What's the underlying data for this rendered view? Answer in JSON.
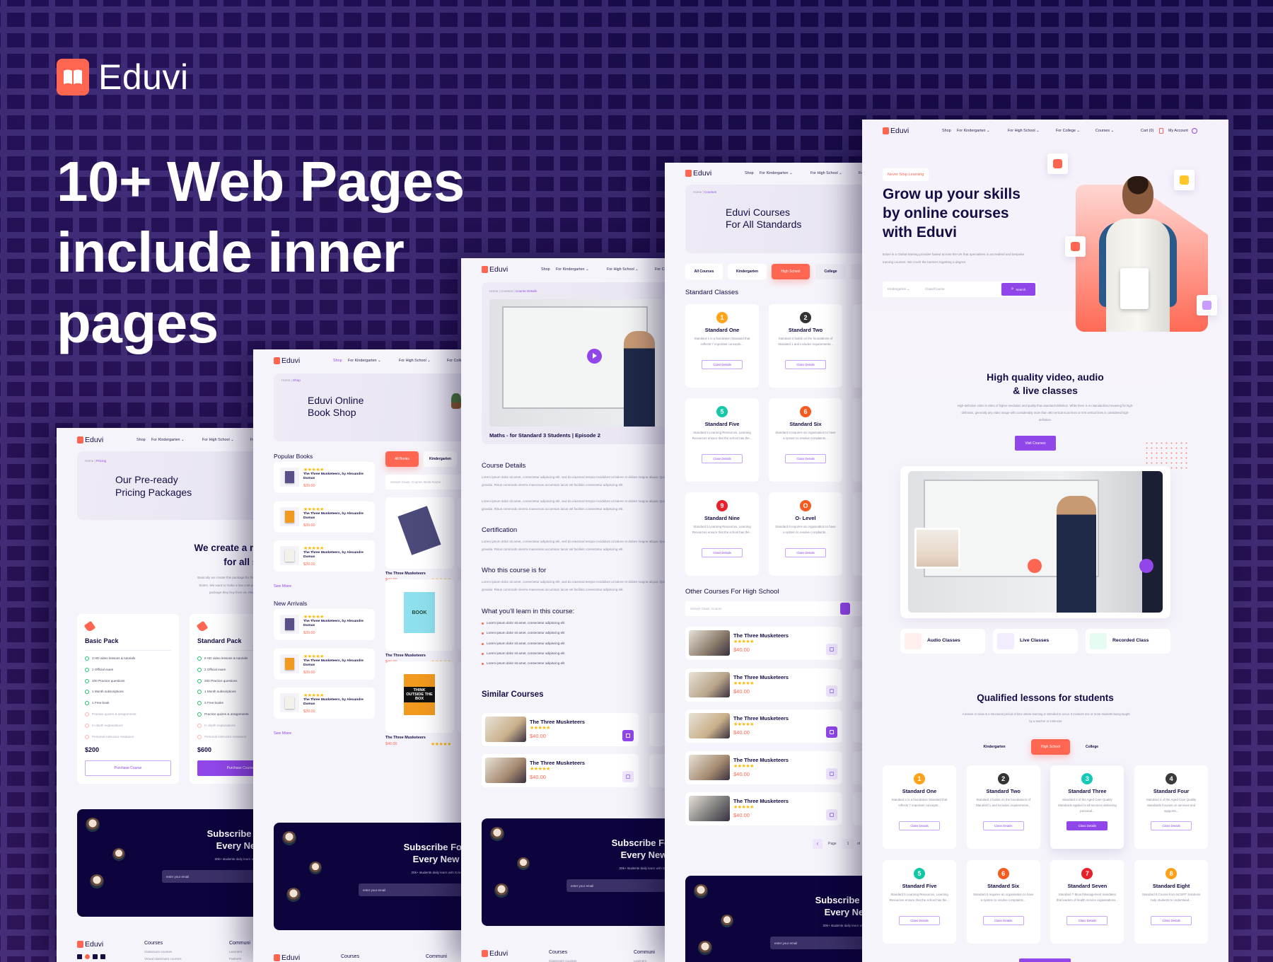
{
  "brand": {
    "name": "Eduvi"
  },
  "colors": {
    "background": "#1d0c4e",
    "accent_purple": "#9146ea",
    "accent_coral": "#ff6652",
    "navy": "#150c45",
    "panel_bg": "#f6f4fb",
    "star": "#ffb800"
  },
  "headline": [
    "10+ Web Pages",
    "include inner",
    "pages"
  ],
  "nav": {
    "items": [
      "Shop",
      "For Kindergarten",
      "For High School",
      "For College",
      "Courses"
    ],
    "cart": "Cart (0)",
    "account": "My Account"
  },
  "subscribe": {
    "title": [
      "Subscribe For Get",
      "Every New Co"
    ],
    "subtitle": "20k+ students daily learn with Eduvi. Subscri",
    "placeholder": "enter your email"
  },
  "footer": {
    "columns": [
      {
        "title": "Courses",
        "links": [
          "Classroom courses",
          "Virtual classroom courses"
        ]
      },
      {
        "title": "Communi",
        "links": [
          "Learners",
          "Partners"
        ]
      }
    ]
  },
  "pricing": {
    "breadcrumb": [
      "Home",
      "Pricing"
    ],
    "title": [
      "Our Pre-ready",
      "Pricing Packages"
    ],
    "heading": [
      "We create a monthly",
      "for all standard"
    ],
    "description": [
      "Basically we create this package for those who are really int",
      "books. We want to make a low cost package for them. So",
      "package they buy from us. Also will get free"
    ],
    "packs": [
      {
        "name": "Basic Pack",
        "price": "$200",
        "button": "Purchase Course",
        "features": [
          {
            "text": "3 HD video lessons & tutorials",
            "included": true
          },
          {
            "text": "1 Official exam",
            "included": true
          },
          {
            "text": "100 Practice questions",
            "included": true
          },
          {
            "text": "1 Month subscriptions",
            "included": true
          },
          {
            "text": "1 Free book",
            "included": true
          },
          {
            "text": "Practice quizes & assignments",
            "included": false
          },
          {
            "text": "In depth explanations",
            "included": false
          },
          {
            "text": "Personal instructor Assitance",
            "included": false
          }
        ]
      },
      {
        "name": "Standard Pack",
        "price": "$600",
        "button": "Purchase Course",
        "features": [
          {
            "text": "8 HD video lessons & tutorials",
            "included": true
          },
          {
            "text": "2 Official exam",
            "included": true
          },
          {
            "text": "200 Practice questions",
            "included": true
          },
          {
            "text": "1 Month subscriptions",
            "included": true
          },
          {
            "text": "3 Free books",
            "included": true
          },
          {
            "text": "Practice quizes & assignments",
            "included": true
          },
          {
            "text": "In depth explanations",
            "included": false
          },
          {
            "text": "Personal instructor Assitance",
            "included": false
          }
        ]
      }
    ]
  },
  "shop": {
    "breadcrumb": [
      "Home",
      "Shop"
    ],
    "title": [
      "Eduvi Online",
      "Book Shop"
    ],
    "popular_title": "Popular Books",
    "new_title": "New Arrivals",
    "see_more": "See More",
    "popular": [
      {
        "title": "The Three Musketeers, by Alexandre Dumas",
        "price": "$39.00",
        "rating": 5,
        "cover": "#5a4f86"
      },
      {
        "title": "The Three Musketeers, by Alexandre Dumas",
        "price": "$39.00",
        "rating": 5,
        "cover": "#f29a1f"
      },
      {
        "title": "The Three Musketeers, by Alexandre Dumas",
        "price": "$39.00",
        "rating": 5,
        "cover": "#f4f1ea"
      }
    ],
    "new_arrivals": [
      {
        "title": "The Three Musketeers, by Alexandre Dumas",
        "price": "$39.00",
        "rating": 5,
        "cover": "#5a4f86"
      },
      {
        "title": "The Three Musketeers, by Alexandre Dumas",
        "price": "$39.00",
        "rating": 5,
        "cover": "#f29a1f"
      },
      {
        "title": "The Three Musketeers, by Alexandre Dumas",
        "price": "$39.00",
        "rating": 5,
        "cover": "#f4f1ea"
      }
    ],
    "tabs": [
      "All Books",
      "Kindergarten"
    ],
    "search_placeholder": "Serach Class, Course, Book Name",
    "books": [
      {
        "title": "The Three Musketeers",
        "price": "$40.00",
        "rating": 5,
        "cover": "#4b4a7a",
        "cover_text": ""
      },
      {
        "title": "The Three Musketeers",
        "price": "$40.00",
        "rating": 5,
        "cover": "#8fe0ee",
        "cover_text": "BOOK"
      },
      {
        "title": "The Three Musketeers",
        "price": "$40.00",
        "rating": 5,
        "cover": "#f29a1f",
        "cover_text": "THINK OUTSIDE THE BOX"
      }
    ]
  },
  "course_details": {
    "breadcrumb": [
      "Home",
      "Courses",
      "Course Details"
    ],
    "caption": "Maths - for Standard 3 Students | Episode 2",
    "sections": [
      {
        "title": "Course Details",
        "paragraphs": [
          "Lorem ipsum dolor sit amet, consectetur adipiscing elit, sed do eiusmod tempor incididunt ut labore et dolore magna aliqua. Quis ipsum suspendisse ultrices gravida. Risus commodo viverra maecenas accumsan lacus vel facilisis consectetur adipiscing elit.",
          "Lorem ipsum dolor sit amet, consectetur adipiscing elit, sed do eiusmod tempor incididunt ut labore et dolore magna aliqua. Quis ipsum suspendisse ultrices gravida. Risus commodo viverra maecenas accumsan lacus vel facilisis consectetur adipiscing elit."
        ]
      },
      {
        "title": "Certification",
        "paragraphs": [
          "Lorem ipsum dolor sit amet, consectetur adipiscing elit, sed do eiusmod tempor incididunt ut labore et dolore magna aliqua. Quis ipsum suspendisse ultrices gravida. Risus commodo viverra maecenas accumsan lacus vel facilisis consectetur adipiscing elit."
        ]
      },
      {
        "title": "Who this course is for",
        "paragraphs": [
          "Lorem ipsum dolor sit amet, consectetur adipiscing elit, sed do eiusmod tempor incididunt ut labore et dolore magna aliqua. Quis ipsum suspendisse ultrices gravida. Risus commodo viverra maecenas accumsan lacus vel facilisis consectetur adipiscing elit."
        ]
      }
    ],
    "learn_title": "What you'll learn in this course:",
    "learn_items": [
      "Lorem ipsum dolor sit amet, consectetur adipiscing elit",
      "Lorem ipsum dolor sit amet, consectetur adipiscing elit",
      "Lorem ipsum dolor sit amet, consectetur adipiscing elit",
      "Lorem ipsum dolor sit amet, consectetur adipiscing elit",
      "Lorem ipsum dolor sit amet, consectetur adipiscing elit"
    ],
    "similar_title": "Similar Courses",
    "similar": [
      {
        "title": "The Three Musketeers",
        "price": "$40.00",
        "rating": 5,
        "cart_active": true
      },
      {
        "title": "The Three Musketeers",
        "price": "$40.00",
        "rating": 5,
        "cart_active": false
      }
    ]
  },
  "courses": {
    "breadcrumb": [
      "Home",
      "Courses"
    ],
    "title": [
      "Eduvi Courses",
      "For All Standards"
    ],
    "tabs": [
      "All Courses",
      "Kindergarten",
      "High School",
      "College"
    ],
    "active_tab": 2,
    "standard_title": "Standard Classes",
    "cards": [
      {
        "num": "1",
        "color": "#ffa31a",
        "title": "Standard One",
        "desc": "Standard 1 is a foundation Standard that reflects 7 important concepts...",
        "button": "Class Details"
      },
      {
        "num": "2",
        "color": "#333333",
        "title": "Standard Two",
        "desc": "Standard 2 builds on the foundations of Standard 1 and includes requirements...",
        "button": "Class Details"
      },
      {
        "num": "5",
        "color": "#14c9a8",
        "title": "Standard Five",
        "desc": "Standard 5 Learning Resources. Learning Resources ensure that the school has the...",
        "button": "Class Details"
      },
      {
        "num": "6",
        "color": "#f55a1e",
        "title": "Standard Six",
        "desc": "Standard 6 requires an organisation to have a system to resolve complaints...",
        "button": "Class Details"
      },
      {
        "num": "9",
        "color": "#e8202a",
        "title": "Standard Nine",
        "desc": "Standard 5 Learning Resources. Learning Resources ensure that the school has the...",
        "button": "Class Details"
      },
      {
        "num": "O",
        "color": "#f55a1e",
        "title": "O- Level",
        "desc": "Standard 6 requires an organisation to have a system to resolve complaints...",
        "button": "Class Details"
      }
    ],
    "other_title": "Other Courses For High School",
    "search_placeholder": "Serach Class, Course",
    "list": [
      {
        "title": "The Three Musketeers",
        "price": "$40.00",
        "rating": 5,
        "cart_active": false
      },
      {
        "title": "The Three Musketeers",
        "price": "$40.00",
        "rating": 5,
        "cart_active": false
      },
      {
        "title": "The Three Musketeers",
        "price": "$40.00",
        "rating": 5,
        "cart_active": true
      },
      {
        "title": "The Three Musketeers",
        "price": "$40.00",
        "rating": 5,
        "cart_active": false
      },
      {
        "title": "The Three Musketeers",
        "price": "$40.00",
        "rating": 5,
        "cart_active": false
      }
    ],
    "pagination": {
      "label": "Page",
      "current": "1",
      "of": "of"
    }
  },
  "home": {
    "badge": "Never Stop Learning",
    "title": [
      "Grow up your skills",
      "by online courses",
      "with Eduvi"
    ],
    "description": "Eduvi is a Global training provider based across the UK that specialises in accredited and bespoke training courses. We crush the barriers togetting a degree.",
    "search": {
      "select": "Kindergarten",
      "placeholder": "Class/Course",
      "button": "Search"
    },
    "video_title": [
      "High quality video, audio",
      "& live classes"
    ],
    "video_desc": "High-definition video is video of higher resolution and quality than standard-definition. While there is no standardized meaning for high-definition, generally any video image with considerably more than 480 vertical scan lines or 576 vertical lines is considered high-definition.",
    "visit_button": "Visit Courses",
    "features": [
      {
        "label": "Audio Classes",
        "icon": "speaker-icon",
        "tint": "#fff0ee"
      },
      {
        "label": "Live Classes",
        "icon": "live-icon",
        "tint": "#f3ecff"
      },
      {
        "label": "Recorded Class",
        "icon": "play-icon",
        "tint": "#e6fbf1"
      }
    ],
    "lessons_title": "Qualified lessons for students",
    "lessons_desc": "A lesson or class is a structured period of time where learning is intended to occur. It involves one or more students being taught by a teacher or instructor.",
    "tabs": [
      "Kindergarten",
      "High School",
      "College"
    ],
    "active_tab": 1,
    "cards": [
      {
        "num": "1",
        "color": "#ffa31a",
        "title": "Standard One",
        "desc": "Standard 1 is a foundation Standard that reflects 7 important concepts...",
        "button": "Class Details",
        "active": false
      },
      {
        "num": "2",
        "color": "#333333",
        "title": "Standard Two",
        "desc": "Standard 2 builds on the foundations of Standard 1 and includes requirements...",
        "button": "Class Details",
        "active": false
      },
      {
        "num": "3",
        "color": "#14c9b5",
        "title": "Standard Three",
        "desc": "Standard 3 of the Aged Care Quality Standards applies to all services delivering personal...",
        "button": "Class Details",
        "active": true
      },
      {
        "num": "4",
        "color": "#3a3a3a",
        "title": "Standard Four",
        "desc": "Standard 4 of the Aged Care Quality Standards focuses on services and supports...",
        "button": "Class Details",
        "active": false
      },
      {
        "num": "5",
        "color": "#12c7a5",
        "title": "Standard Five",
        "desc": "Standard 5 Learning Resources. Learning Resources ensure that the school has the...",
        "button": "Class Details",
        "active": false
      },
      {
        "num": "6",
        "color": "#f55a1e",
        "title": "Standard Six",
        "desc": "Standard 6 requires an organisation to have a system to resolve complaints...",
        "button": "Class Details",
        "active": false
      },
      {
        "num": "7",
        "color": "#e8202a",
        "title": "Standard Seven",
        "desc": "Standard 7 Blood Management mandates that leaders of health service organisations...",
        "button": "Class Details",
        "active": false
      },
      {
        "num": "8",
        "color": "#ffa11a",
        "title": "Standard Eight",
        "desc": "Standard 8 Course from NCERT Solutions help students to understand...",
        "button": "Class Details",
        "active": false
      }
    ]
  }
}
